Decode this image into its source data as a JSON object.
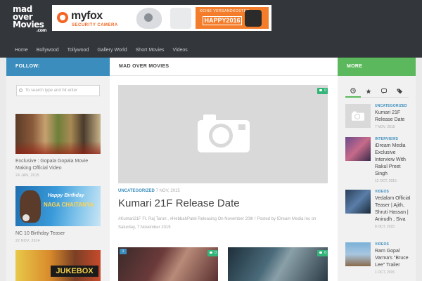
{
  "site": {
    "logo_line1": "mad",
    "logo_line2": "over",
    "logo_line3": "Movies",
    "logo_line4": ".com"
  },
  "ad": {
    "brand": "myfox",
    "tagline": "SECURITY CAMERA",
    "banner_small": "KEINE VERSANDKOSTEN",
    "banner_code": "HAPPY2016"
  },
  "nav": {
    "items": [
      "Home",
      "Bollywood",
      "Tollywood",
      "Gallery World",
      "Short Movies",
      "Videos"
    ]
  },
  "left_sidebar": {
    "header": "FOLLOW:",
    "search_placeholder": "To search type and hit enter",
    "posts": [
      {
        "title": "Exclusive : Gopala Gopala Movie Making Official Video",
        "date": "24 JAN, 2015",
        "overlay": ""
      },
      {
        "title": "NC 10 Birthday Teaser",
        "date": "22 NOV, 2014",
        "overlay_top": "Happy Birthday",
        "overlay_bottom": "NAGA CHAITANYA"
      },
      {
        "title": "",
        "date": "",
        "overlay": "JUKEBOX"
      }
    ]
  },
  "main": {
    "header": "MAD OVER MOVIES",
    "featured": {
      "comments": "0",
      "category": "UNCATEGORIZED",
      "date": "7 NOV, 2015",
      "title": "Kumari 21F Release Date",
      "excerpt": "#Kumari21F Ft. Raj Tarun , #HebbahPatel Releasing On November 20th ! Posted by IDream Media Inc on Saturday, 7 November 2015"
    },
    "small_posts": [
      {
        "comments": "0",
        "badge": "1"
      },
      {
        "comments": "0"
      }
    ]
  },
  "right_sidebar": {
    "header": "MORE",
    "tabs": [
      "recent-icon",
      "star-icon",
      "comments-icon",
      "tags-icon"
    ],
    "posts": [
      {
        "category": "UNCATEGORIZED",
        "title": "Kumari 21F Release Date",
        "date": "7 NOV, 2015"
      },
      {
        "category": "INTERVIEWS",
        "title": "iDream Media Exclusive Interview With Rakul Preet Singh",
        "date": "12 OCT, 2015"
      },
      {
        "category": "VIDEOS",
        "title": "Vedalam Official Teaser | Ajith, Shruti Hassan | Anirudh , Siva",
        "date": "8 OCT, 2015"
      },
      {
        "category": "VIDEOS",
        "title": "Ram Gopal Varma's \"Bruce Lee\" Trailer",
        "date": "1 OCT, 2015"
      }
    ]
  },
  "colors": {
    "header_bg": "#33363b",
    "follow_blue": "#3b8dbd",
    "more_green": "#5cb85c",
    "comment_green": "#33b57a"
  }
}
